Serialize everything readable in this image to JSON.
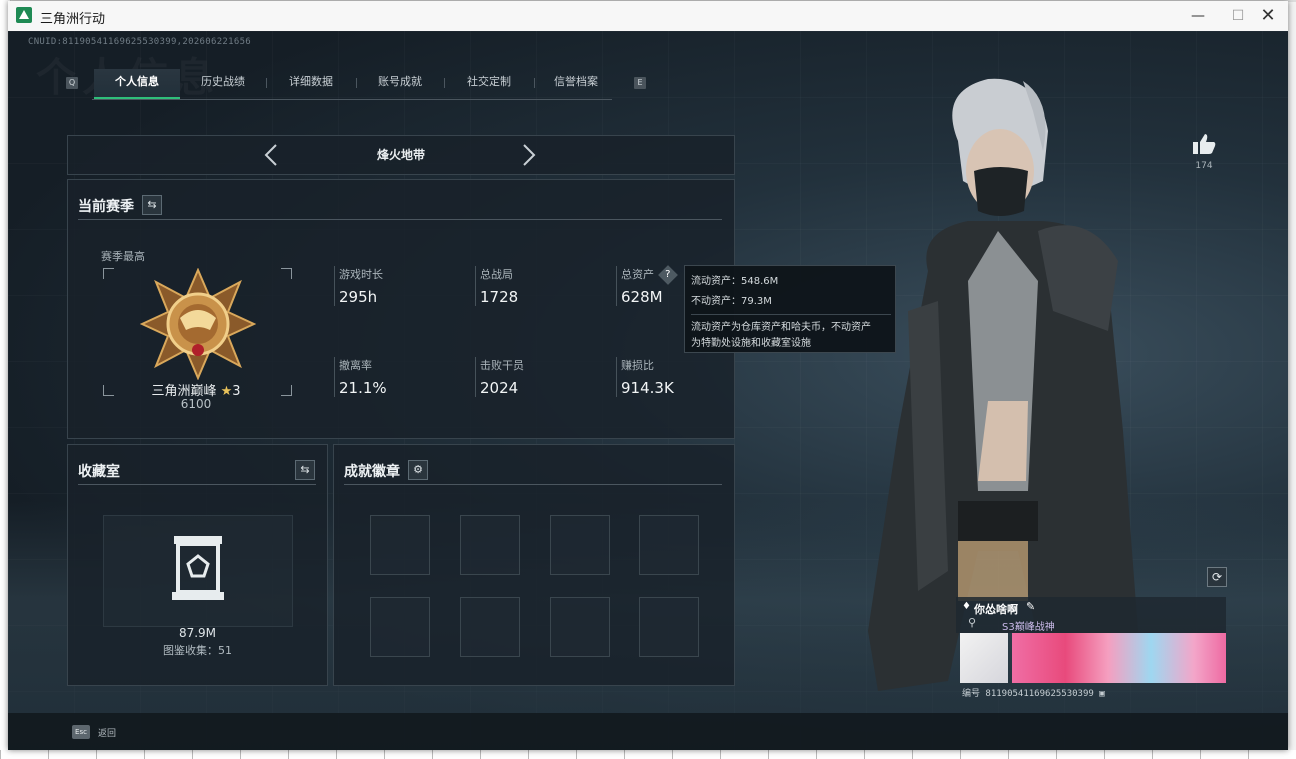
{
  "window": {
    "title": "三角洲行动"
  },
  "header": {
    "uid": "CNUID:81190541169625530399,202606221656"
  },
  "tabs": [
    {
      "label": "个人信息",
      "active": true
    },
    {
      "label": "历史战绩"
    },
    {
      "label": "详细数据"
    },
    {
      "label": "账号成就"
    },
    {
      "label": "社交定制"
    },
    {
      "label": "信誉档案"
    }
  ],
  "tab_keys": {
    "left": "Q",
    "right": "E"
  },
  "map": {
    "name": "烽火地带"
  },
  "season": {
    "title": "当前赛季",
    "best_label": "赛季最高",
    "rank_name": "三角洲巅峰",
    "rank_stars": "3",
    "rank_score": "6100",
    "stats": [
      {
        "label": "游戏时长",
        "value": "295h"
      },
      {
        "label": "总战局",
        "value": "1728"
      },
      {
        "label": "总资产",
        "value": "628M"
      },
      {
        "label": "撤离率",
        "value": "21.1%"
      },
      {
        "label": "击败干员",
        "value": "2024"
      },
      {
        "label": "赚损比",
        "value": "914.3K"
      }
    ]
  },
  "tooltip": {
    "liquid": "流动资产：548.6M",
    "fixed": "不动资产：79.3M",
    "desc1": "流动资产为仓库资产和哈夫币，不动资产",
    "desc2": "为特勤处设施和收藏室设施"
  },
  "collection": {
    "title": "收藏室",
    "value": "87.9M",
    "count_label": "图鉴收集：51"
  },
  "badges": {
    "title": "成就徽章"
  },
  "likes": {
    "count": "174"
  },
  "card": {
    "player_name": "你怂啥啊",
    "player_title": "S3巅峰战神",
    "player_id": "编号 81190541169625530399"
  },
  "footer": {
    "esc_key": "Esc",
    "esc_label": "返回"
  },
  "colors": {
    "accent": "#2fbf7a",
    "panel": "#182129",
    "background": "#151e26"
  }
}
